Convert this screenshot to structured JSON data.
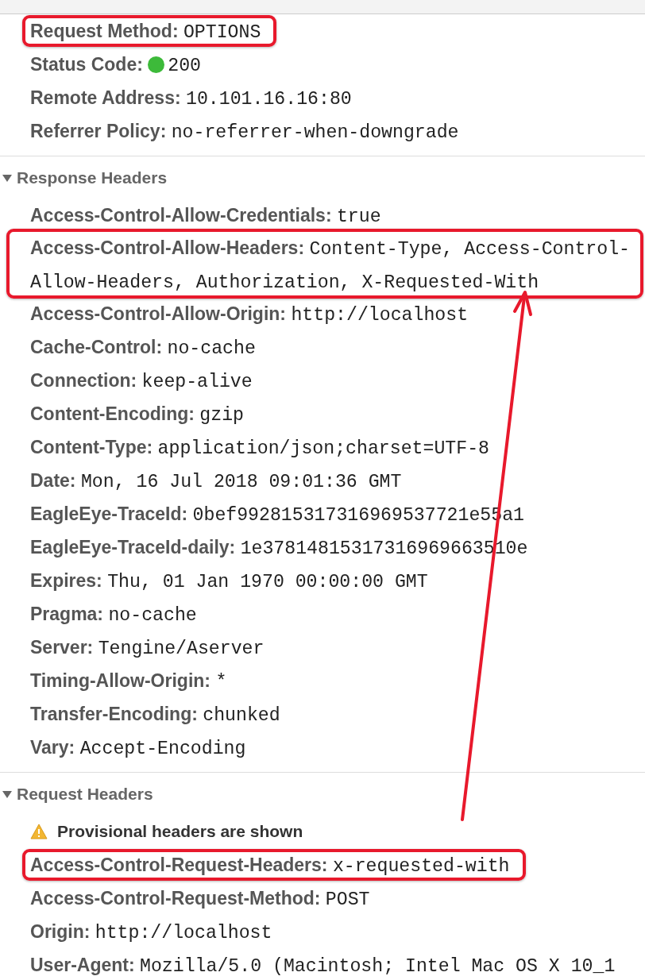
{
  "general": {
    "rows": [
      {
        "label": "Request Method:",
        "value": "OPTIONS",
        "highlighted": true
      },
      {
        "label": "Status Code:",
        "value": "200",
        "color": "#3dba3a",
        "highlighted": false
      },
      {
        "label": "Remote Address:",
        "value": "10.101.16.16:80",
        "highlighted": false
      },
      {
        "label": "Referrer Policy:",
        "value": "no-referrer-when-downgrade",
        "highlighted": false
      }
    ]
  },
  "sections": [
    {
      "title": "Response Headers",
      "expanded": true,
      "rows": [
        {
          "label": "Access-Control-Allow-Credentials:",
          "value": "true",
          "highlighted": false
        },
        {
          "label": "Access-Control-Allow-Headers:",
          "value": "Content-Type, Access-Control-Allow-Headers, Authorization, X-Requested-With",
          "highlighted": true
        },
        {
          "label": "Access-Control-Allow-Origin:",
          "value": "http://localhost",
          "highlighted": false
        },
        {
          "label": "Cache-Control:",
          "value": "no-cache",
          "highlighted": false
        },
        {
          "label": "Connection:",
          "value": "keep-alive",
          "highlighted": false
        },
        {
          "label": "Content-Encoding:",
          "value": "gzip",
          "highlighted": false
        },
        {
          "label": "Content-Type:",
          "value": "application/json;charset=UTF-8",
          "highlighted": false
        },
        {
          "label": "Date:",
          "value": "Mon, 16 Jul 2018 09:01:36 GMT",
          "highlighted": false
        },
        {
          "label": "EagleEye-TraceId:",
          "value": "0bef992815317316969537721e55a1",
          "highlighted": false
        },
        {
          "label": "EagleEye-TraceId-daily:",
          "value": "1e37814815317316969663510e",
          "highlighted": false
        },
        {
          "label": "Expires:",
          "value": "Thu, 01 Jan 1970 00:00:00 GMT",
          "highlighted": false
        },
        {
          "label": "Pragma:",
          "value": "no-cache",
          "highlighted": false
        },
        {
          "label": "Server:",
          "value": "Tengine/Aserver",
          "highlighted": false
        },
        {
          "label": "Timing-Allow-Origin:",
          "value": "*",
          "highlighted": false
        },
        {
          "label": "Transfer-Encoding:",
          "value": "chunked",
          "highlighted": false
        },
        {
          "label": "Vary:",
          "value": "Accept-Encoding",
          "highlighted": false
        }
      ]
    },
    {
      "title": "Request Headers",
      "expanded": true,
      "warning": "Provisional headers are shown",
      "rows": [
        {
          "label": "Access-Control-Request-Headers:",
          "value": "x-requested-with",
          "highlighted": true
        },
        {
          "label": "Access-Control-Request-Method:",
          "value": "POST",
          "highlighted": false
        },
        {
          "label": "Origin:",
          "value": "http://localhost",
          "highlighted": false
        },
        {
          "label": "User-Agent:",
          "value": "Mozilla/5.0 (Macintosh; Intel Mac OS X 10_1",
          "highlighted": false
        }
      ]
    }
  ]
}
